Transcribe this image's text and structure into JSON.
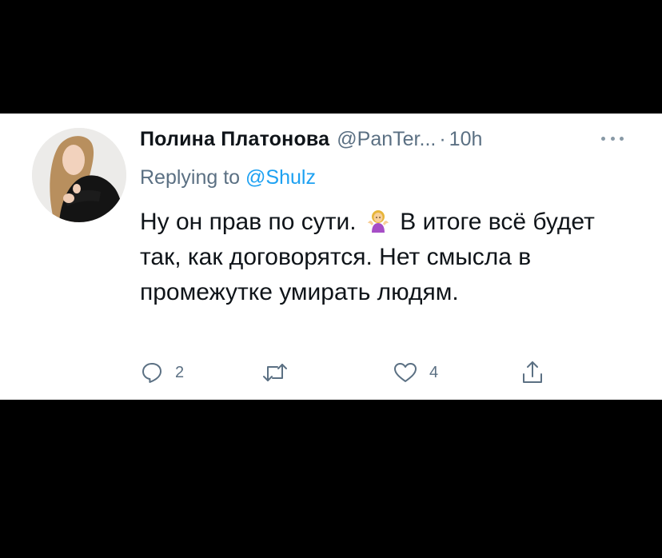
{
  "tweet": {
    "author": {
      "name": "Полина Платонова",
      "handle": "@PanTer...",
      "avatar_icon": "profile-photo"
    },
    "separator": "·",
    "timestamp": "10h",
    "reply": {
      "prefix": "Replying to",
      "target": "@Shulz"
    },
    "text": {
      "part1": "Ну он прав по сути.",
      "emoji": "woman-shrugging",
      "part2": "В итоге всё будет так, как договорятся. Нет смысла в промежутке умирать людям."
    },
    "actions": {
      "reply_count": "2",
      "retweet_count": "",
      "like_count": "4"
    }
  },
  "colors": {
    "text_primary": "#0f1419",
    "text_secondary": "#5b7083",
    "link": "#1da1f2",
    "background": "#ffffff",
    "frame": "#000000"
  }
}
